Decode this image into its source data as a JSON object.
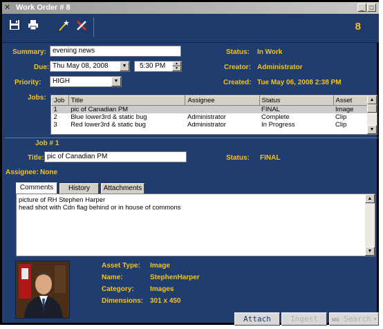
{
  "window": {
    "title": "Work Order # 8",
    "minimize": "_",
    "maximize": "□"
  },
  "toolbar": {
    "counter": "8"
  },
  "fields": {
    "summary_label": "Summary:",
    "summary_value": "evening news",
    "due_label": "Due:",
    "due_date": "Thu May 08, 2008",
    "due_time": "5:30 PM",
    "priority_label": "Priority:",
    "priority_value": "HIGH",
    "status_label": "Status:",
    "status_value": "In Work",
    "creator_label": "Creator:",
    "creator_value": "Administrator",
    "created_label": "Created:",
    "created_value": "Tue May 06, 2008 2:38 PM",
    "jobs_label": "Jobs:"
  },
  "jobs": {
    "columns": [
      "Job",
      "Title",
      "Assignee",
      "Status",
      "Asset"
    ],
    "rows": [
      [
        "1",
        "pic of Canadian PM",
        "",
        "FINAL",
        "Image"
      ],
      [
        "2",
        "Blue lower3rd & static bug",
        "Administrator",
        "Complete",
        "Clip"
      ],
      [
        "3",
        "Red lower3rd & static bug",
        "Administrator",
        "In Progress",
        "Clip"
      ]
    ]
  },
  "job_detail": {
    "header": "Job # 1",
    "title_label": "Title:",
    "title_value": "pic of Canadian PM",
    "status_label": "Status:",
    "status_value": "FINAL",
    "assignee_label": "Assignee:",
    "assignee_value": "None"
  },
  "tabs": [
    "Comments",
    "History",
    "Attachments"
  ],
  "comments": {
    "line1": "picture of RH Stephen Harper",
    "line2": "head shot with Cdn flag behind or in house of commons"
  },
  "asset": {
    "type_label": "Asset Type:",
    "type_value": "Image",
    "name_label": "Name:",
    "name_value": "StephenHarper",
    "category_label": "Category:",
    "category_value": "Images",
    "dimensions_label": "Dimensions:",
    "dimensions_value": "301 x 450"
  },
  "buttons": {
    "attach": "Attach",
    "ingest": "Ingest",
    "search": "Search",
    "search_prefix": "MS"
  }
}
